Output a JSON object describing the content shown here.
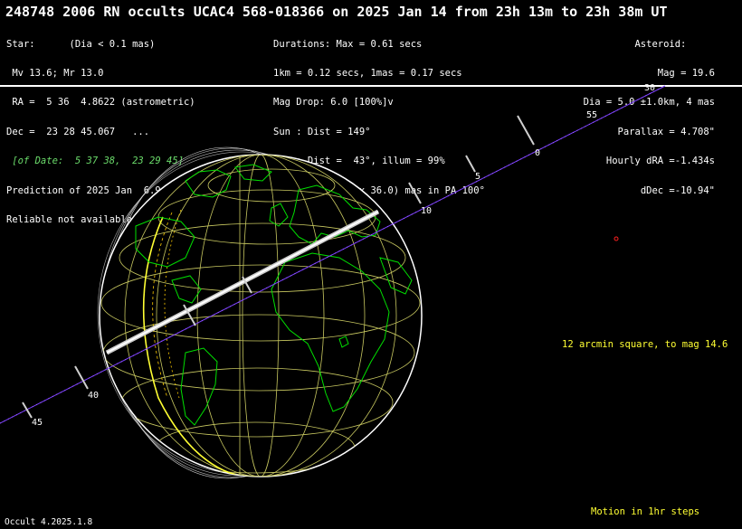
{
  "title": "248748 2006 RN occults UCAC4 568-018366 on 2025 Jan 14 from 23h 13m to 23h 38m UT",
  "star": {
    "l1": "Star:      (Dia < 0.1 mas)",
    "l2": " Mv 13.6; Mr 13.0",
    "l3": " RA =  5 36  4.8622 (astrometric)",
    "l4": "Dec =  23 28 45.067   ...",
    "l5": " [of Date:  5 37 38,  23 29 45]",
    "l6": "Prediction of 2025 Jan  6.9",
    "l7": "Reliable not available"
  },
  "durations": {
    "l1": "Durations: Max = 0.61 secs",
    "l2": "1km = 0.12 secs, 1mas = 0.17 secs",
    "l3": "Mag Drop: 6.0 [100%]v",
    "l4": "Sun : Dist = 149°",
    "l5": "Moon: Dist =  43°, illum = 99%",
    "l6": "1σ Err: ±(58.0 x 36.0) mas in PA 100°"
  },
  "asteroid": {
    "l1": "Asteroid:     ",
    "l2": "Mag = 19.6",
    "l3": "Dia = 5.0 ±1.0km, 4 mas",
    "l4": "Parallax = 4.708\"",
    "l5": "Hourly dRA =-1.434s",
    "l6": "dDec =-10.94\""
  },
  "star_chart_note": "12 arcmin square, to mag 14.6",
  "motion_note": "Motion in 1hr steps",
  "footer": "Occult 4.2025.1.8",
  "track_ticks": [
    "30",
    "55",
    "0",
    "5",
    "10",
    "40",
    "45"
  ],
  "colors": {
    "track": "#7a3fff",
    "coast": "#00e000",
    "grid": "#c8c860",
    "highlight": "#ffff33",
    "path": "#dddddd"
  }
}
